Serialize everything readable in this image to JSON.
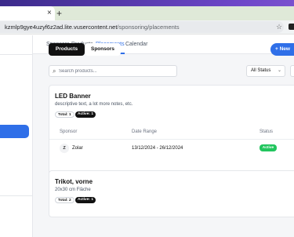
{
  "browser": {
    "tab_close": "×",
    "new_tab": "+",
    "url_host": "kzmlp9gye4uzyf6z2ad.lite.vusercontent.net",
    "url_path": "/sponsoring/placements",
    "star_icon": "star-icon"
  },
  "nav": {
    "items": [
      {
        "label": "Sponsors"
      },
      {
        "label": "Products"
      },
      {
        "label": "Placements"
      },
      {
        "label": "Calendar"
      }
    ],
    "active_index": 2
  },
  "toolbar": {
    "tabs": [
      {
        "label": "Products",
        "active": true
      },
      {
        "label": "Sponsors",
        "active": false
      }
    ],
    "new_button": "+ New",
    "search_placeholder": "Search products...",
    "status_filter": "All Status"
  },
  "products": [
    {
      "title": "LED Banner",
      "description": "descriptive text, a lot more notes, etc.",
      "total_label": "Total: 1",
      "active_label": "Active: 1",
      "columns": [
        "Sponsor",
        "Date Range",
        "Status"
      ],
      "rows": [
        {
          "avatar": "Z",
          "sponsor": "Zolar",
          "date_range": "13/12/2024 - 26/12/2024",
          "status": "Active"
        }
      ]
    },
    {
      "title": "Trikot, vorne",
      "description": "20x30 cm Fläche",
      "total_label": "Total: 2",
      "active_label": "Active: 1"
    }
  ],
  "colors": {
    "accent": "#2f6fe8",
    "active_status": "#22c55e",
    "dark_tab": "#111111"
  }
}
